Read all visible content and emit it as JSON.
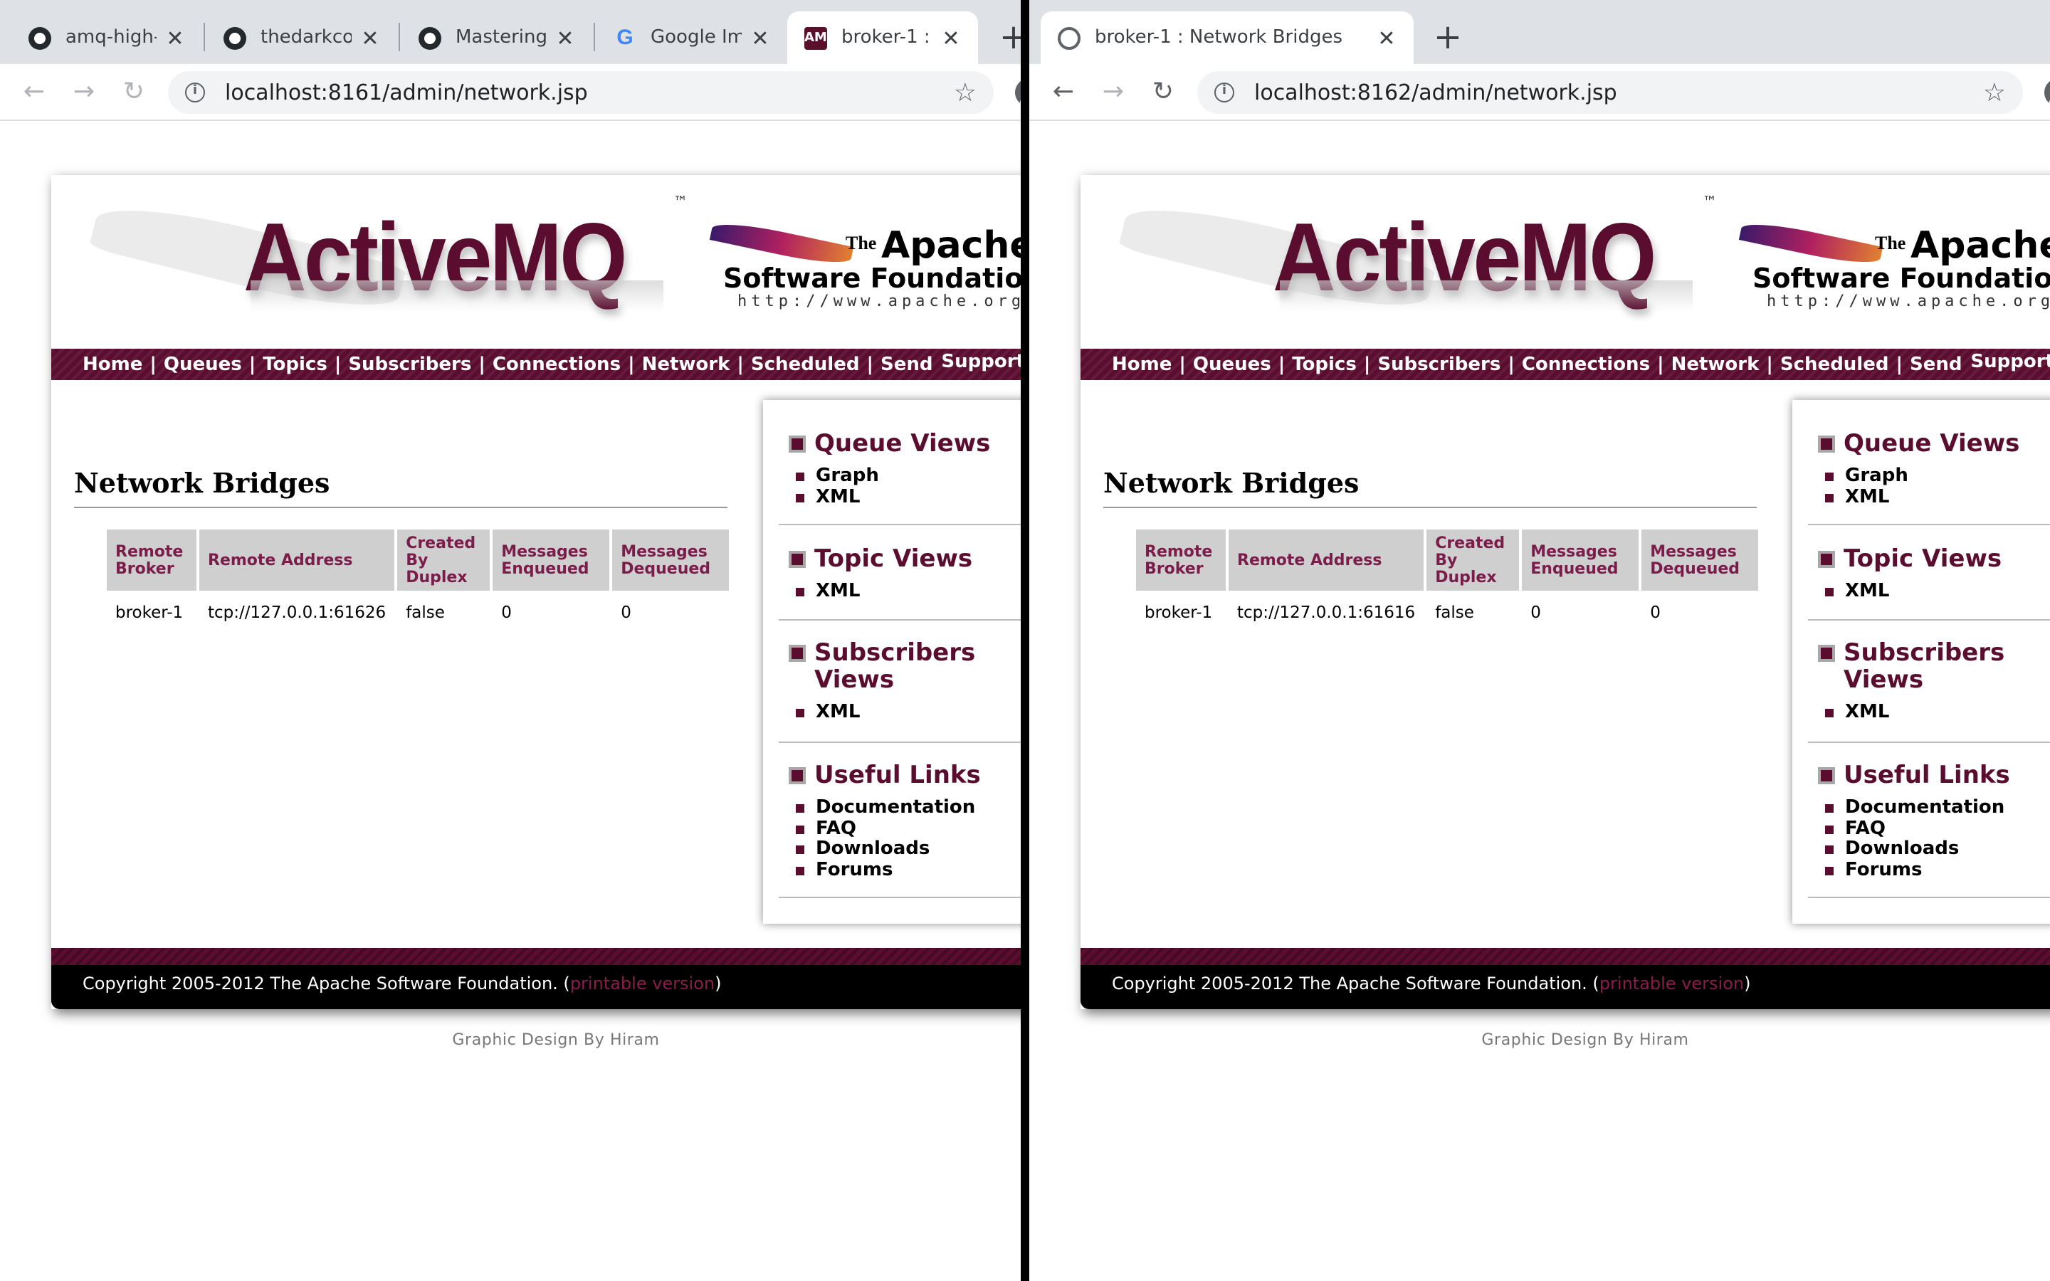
{
  "left": {
    "tabs": [
      {
        "title": "amq-high-",
        "icon": "github-icon"
      },
      {
        "title": "thedarkco",
        "icon": "github-icon"
      },
      {
        "title": "Mastering",
        "icon": "github-icon"
      },
      {
        "title": "Google Im",
        "icon": "google-icon"
      },
      {
        "title": "broker-1 :",
        "icon": "activemq-icon"
      }
    ],
    "url": "localhost:8161/admin/network.jsp",
    "bridge": {
      "remote_broker": "broker-1",
      "remote_address": "tcp://127.0.0.1:61626",
      "created_by_duplex": "false",
      "enqueued": "0",
      "dequeued": "0"
    }
  },
  "right": {
    "tabs": [
      {
        "title": "broker-1 : Network Bridges",
        "icon": "globe-icon"
      }
    ],
    "url": "localhost:8162/admin/network.jsp",
    "bridge": {
      "remote_broker": "broker-1",
      "remote_address": "tcp://127.0.0.1:61616",
      "created_by_duplex": "false",
      "enqueued": "0",
      "dequeued": "0"
    }
  },
  "brand": {
    "logo": "ActiveMQ",
    "tm": "™",
    "asf_the": "The",
    "asf_apache": "Apache",
    "asf_sf": "Software Foundation",
    "asf_url": "http://www.apache.org/"
  },
  "nav": {
    "items": [
      "Home",
      "Queues",
      "Topics",
      "Subscribers",
      "Connections",
      "Network",
      "Scheduled",
      "Send"
    ],
    "separator": "|",
    "support": "Support"
  },
  "page_title": "Network Bridges",
  "table_headers": {
    "remote_broker": "Remote Broker",
    "remote_address": "Remote Address",
    "created_by_duplex": "Created By Duplex",
    "enqueued": "Messages Enqueued",
    "dequeued": "Messages Dequeued"
  },
  "sidebar": {
    "queue_views": {
      "title": "Queue Views",
      "items": [
        "Graph",
        "XML"
      ]
    },
    "topic_views": {
      "title": "Topic Views",
      "items": [
        "XML"
      ]
    },
    "subscribers_views": {
      "title": "Subscribers Views",
      "items": [
        "XML"
      ]
    },
    "useful_links": {
      "title": "Useful Links",
      "items": [
        "Documentation",
        "FAQ",
        "Downloads",
        "Forums"
      ]
    }
  },
  "footer": {
    "copyright": "Copyright 2005-2012 The Apache Software Foundation. (",
    "printable": "printable version",
    "close_paren": ")"
  },
  "credit": "Graphic Design By Hiram",
  "colors": {
    "accent": "#5b0d2f",
    "header_cell": "#cfcfcf",
    "header_text": "#7a1d4a"
  }
}
